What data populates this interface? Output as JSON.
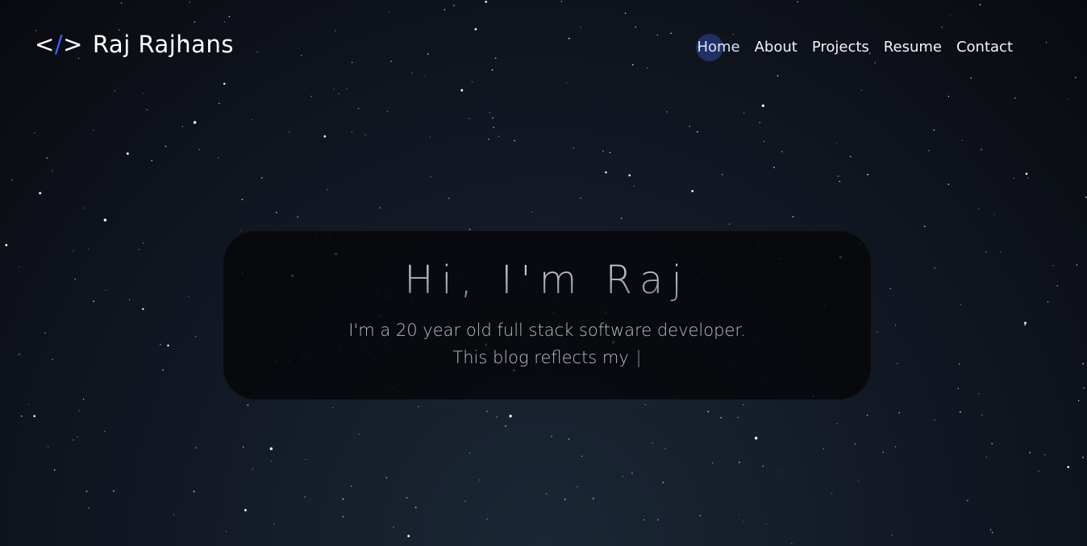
{
  "brand": {
    "code_open": "<",
    "code_slash": "/",
    "code_close": ">",
    "name": "Raj Rajhans",
    "slash_color": "#3b63ff"
  },
  "nav": {
    "items": [
      {
        "label": "Home",
        "active": true
      },
      {
        "label": "About",
        "active": false
      },
      {
        "label": "Projects",
        "active": false
      },
      {
        "label": "Resume",
        "active": false
      },
      {
        "label": "Contact",
        "active": false
      }
    ]
  },
  "hero": {
    "title": "Hi, I'm Raj",
    "subtitle_line1": "I'm a 20 year old full stack software developer.",
    "subtitle_line2": "This blog reflects my",
    "cursor": "|"
  },
  "colors": {
    "bg_center": "#1b2735",
    "bg_edge": "#090a0f",
    "accent": "#3b63ff"
  }
}
